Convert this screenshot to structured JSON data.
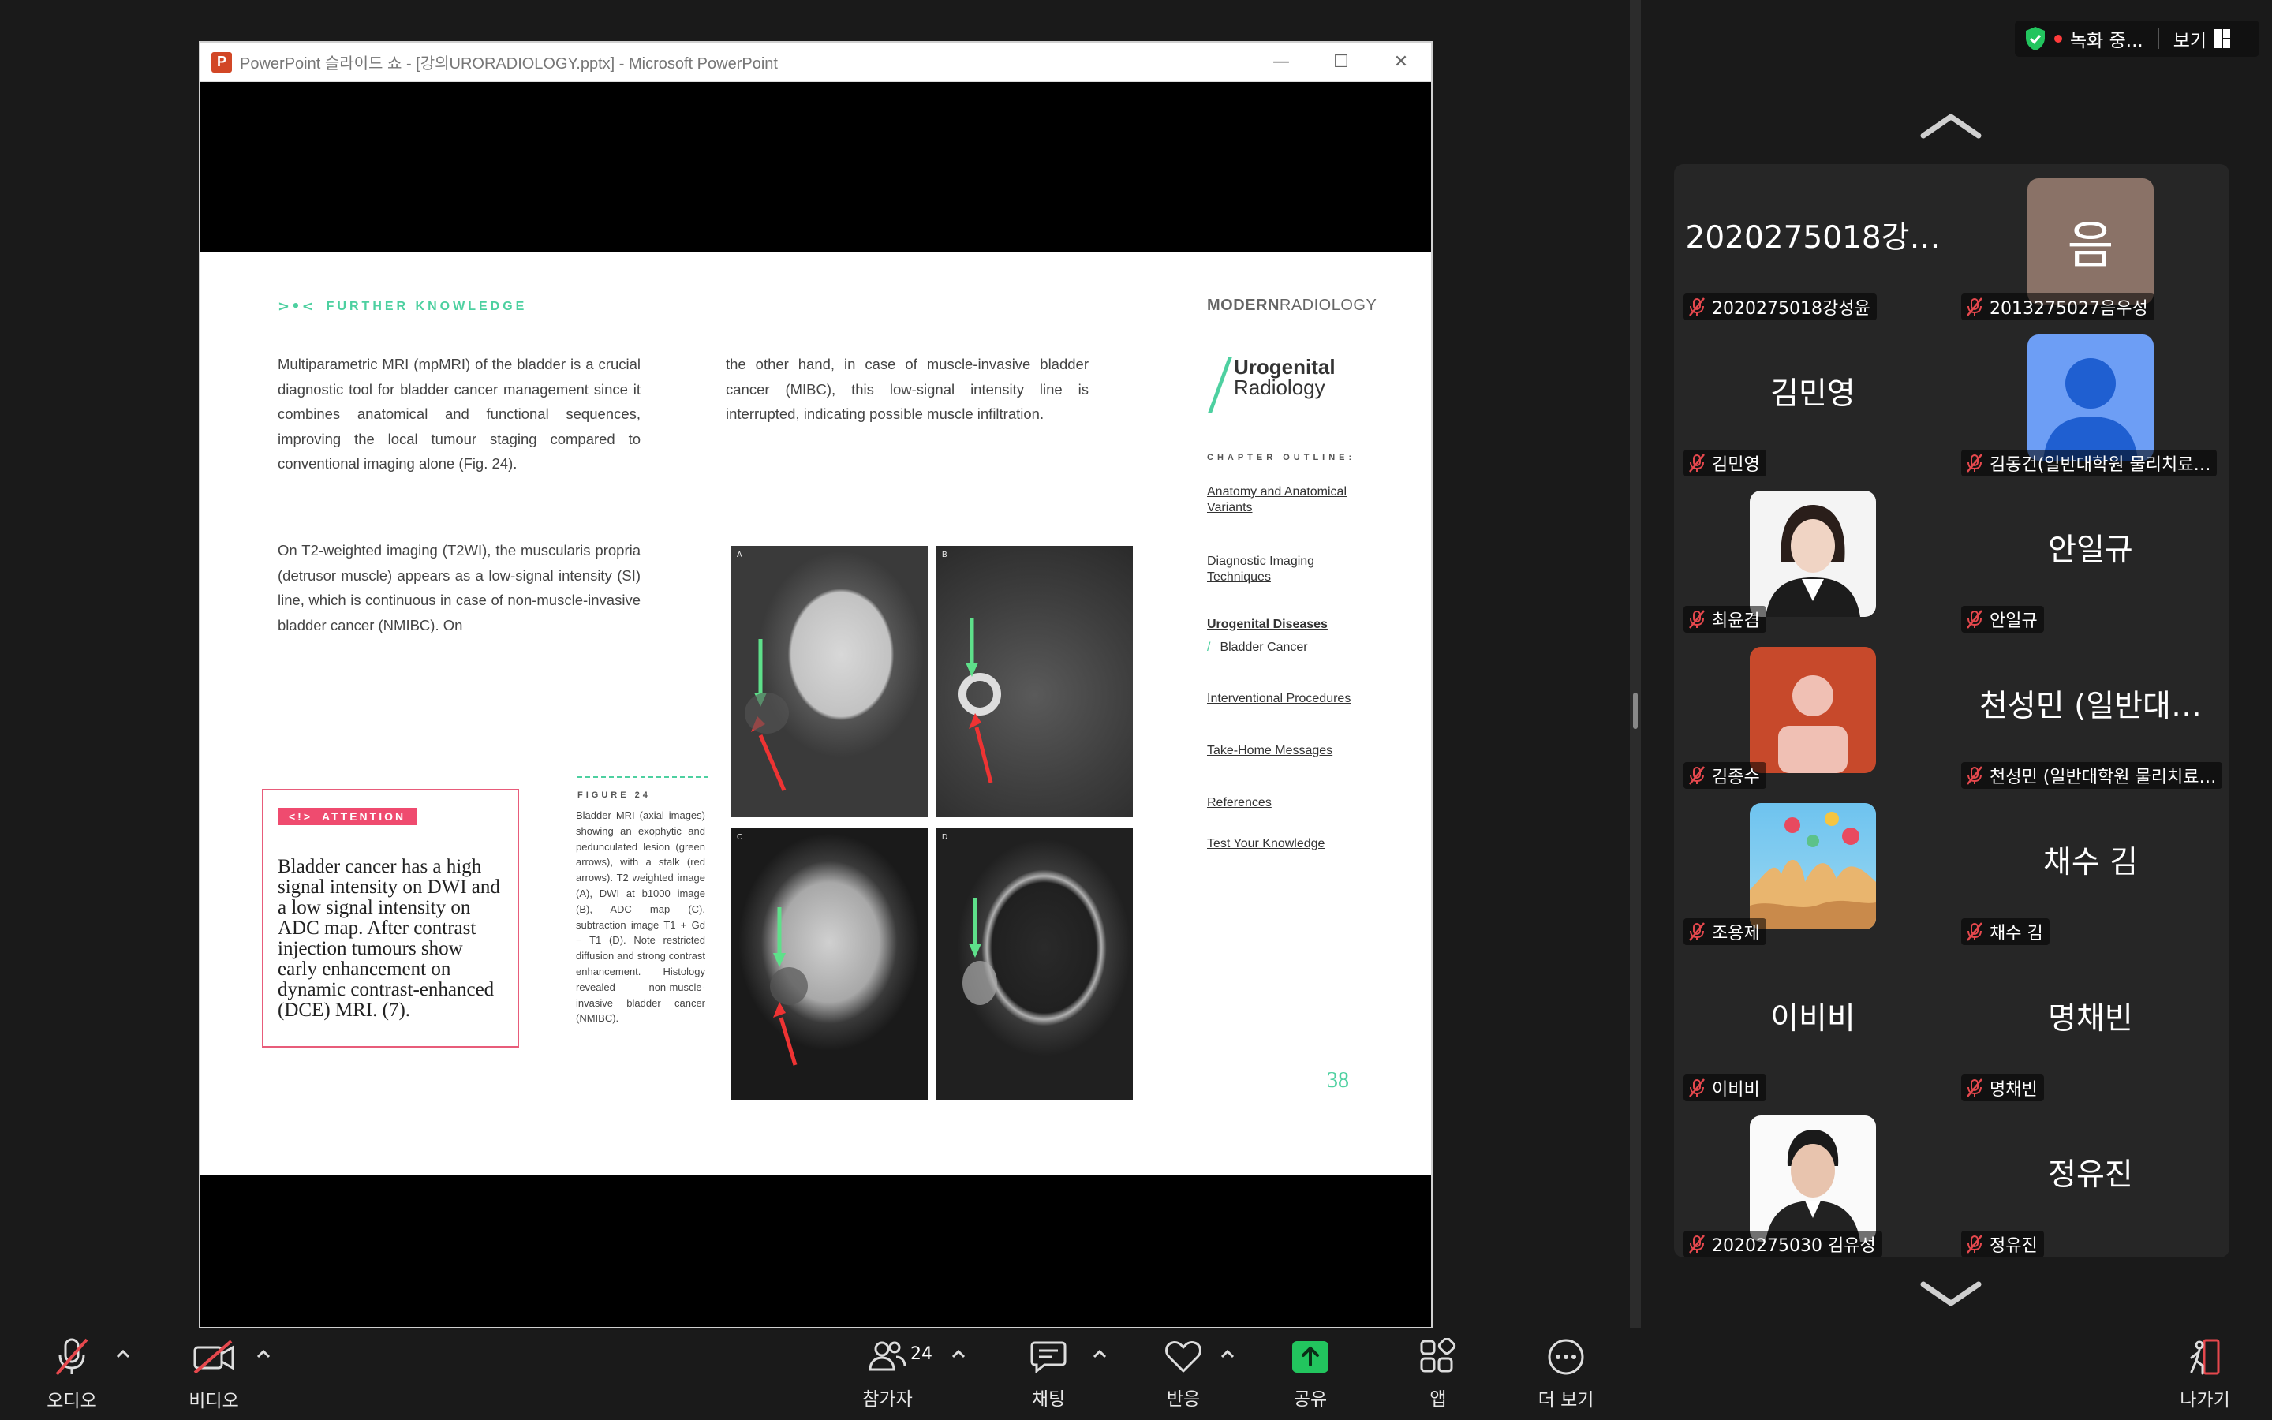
{
  "ppt": {
    "logo_letter": "P",
    "title": "PowerPoint 슬라이드 쇼 - [강의URORADIOLOGY.pptx] - Microsoft PowerPoint",
    "min_glyph": "—",
    "max_glyph": "☐",
    "close_glyph": "✕"
  },
  "slide": {
    "section_arrows": ">•<",
    "section_label": "FURTHER KNOWLEDGE",
    "para1": "Multiparametric MRI (mpMRI) of the bladder is a crucial diagnostic tool for bladder cancer management since it combines anatomical and functional sequences, improving the local tumour staging compared to conventional imaging alone (Fig. 24).",
    "para2": "the other hand, in case of muscle-invasive bladder cancer (MIBC), this low-signal intensity line is interrupted, indicating possible muscle infiltration.",
    "para3": "On T2-weighted imaging (T2WI), the muscularis propria (detrusor muscle) appears as a low-signal intensity (SI) line, which is continuous in case of non-muscle-invasive bladder cancer (NMIBC). On",
    "attention_icon": "<!>",
    "attention_label": "ATTENTION",
    "attention_text": "Bladder cancer has a high signal intensity on DWI and a low signal intensity on ADC map. After contrast injection tumours show early enhancement on dynamic contrast-enhanced (DCE) MRI. (7).",
    "figure_label": "FIGURE 24",
    "figure_caption": "Bladder MRI (axial images) showing an exophytic and pedunculated lesion (green arrows), with a stalk (red arrows). T2 weighted image (A), DWI at b1000 image (B), ADC map (C), subtraction image T1 + Gd − T1 (D). Note restricted diffusion and strong contrast enhancement. Histology revealed non-muscle-invasive bladder cancer (NMIBC).",
    "panels": [
      "A",
      "B",
      "C",
      "D"
    ],
    "logo_bold": "MODERN",
    "logo_light": "RADIOLOGY",
    "uro_line1": "Urogenital",
    "uro_line2": "Radiology",
    "outline_label": "CHAPTER OUTLINE:",
    "outline": [
      "Anatomy and Anatomical Variants",
      "Diagnostic Imaging Techniques",
      "Urogenital Diseases",
      "Interventional Procedures",
      "Take-Home Messages",
      "References",
      "Test Your Knowledge"
    ],
    "outline_sub_slash": "/",
    "outline_sub": "Bladder Cancer",
    "page_number": "38"
  },
  "top_right": {
    "recording": "녹화 중...",
    "view": "보기"
  },
  "participants": [
    {
      "display": "2020275018강…",
      "name": "2020275018강성윤",
      "avatar": null
    },
    {
      "display": "음",
      "name": "2013275027음우성",
      "avatar": "letter",
      "color": "#8a7267"
    },
    {
      "display": "김민영",
      "name": "김민영",
      "avatar": null
    },
    {
      "display": "",
      "name": "김동건(일반대학원 물리치료…",
      "avatar": "default-blue",
      "color": "#6d9ef5"
    },
    {
      "display": "",
      "name": "최윤겸",
      "avatar": "photo-woman"
    },
    {
      "display": "안일규",
      "name": "안일규",
      "avatar": null
    },
    {
      "display": "",
      "name": "김종수",
      "avatar": "default-orange",
      "color": "#c7492b"
    },
    {
      "display": "천성민 (일반대…",
      "name": "천성민 (일반대학원 물리치료…",
      "avatar": null
    },
    {
      "display": "",
      "name": "조용제",
      "avatar": "photo-balloons"
    },
    {
      "display": "채수 김",
      "name": "채수 김",
      "avatar": null
    },
    {
      "display": "이비비",
      "name": "이비비",
      "avatar": null
    },
    {
      "display": "명채빈",
      "name": "명채빈",
      "avatar": null
    },
    {
      "display": "",
      "name": "2020275030 김유성",
      "avatar": "photo-man"
    },
    {
      "display": "정유진",
      "name": "정유진",
      "avatar": null
    }
  ],
  "toolbar": {
    "audio": "오디오",
    "video": "비디오",
    "participants": "참가자",
    "participants_count": "24",
    "chat": "채팅",
    "reactions": "반응",
    "share": "공유",
    "apps": "앱",
    "more": "더 보기",
    "leave": "나가기",
    "share_color": "#22c55e",
    "muted_color": "#e5484d"
  }
}
